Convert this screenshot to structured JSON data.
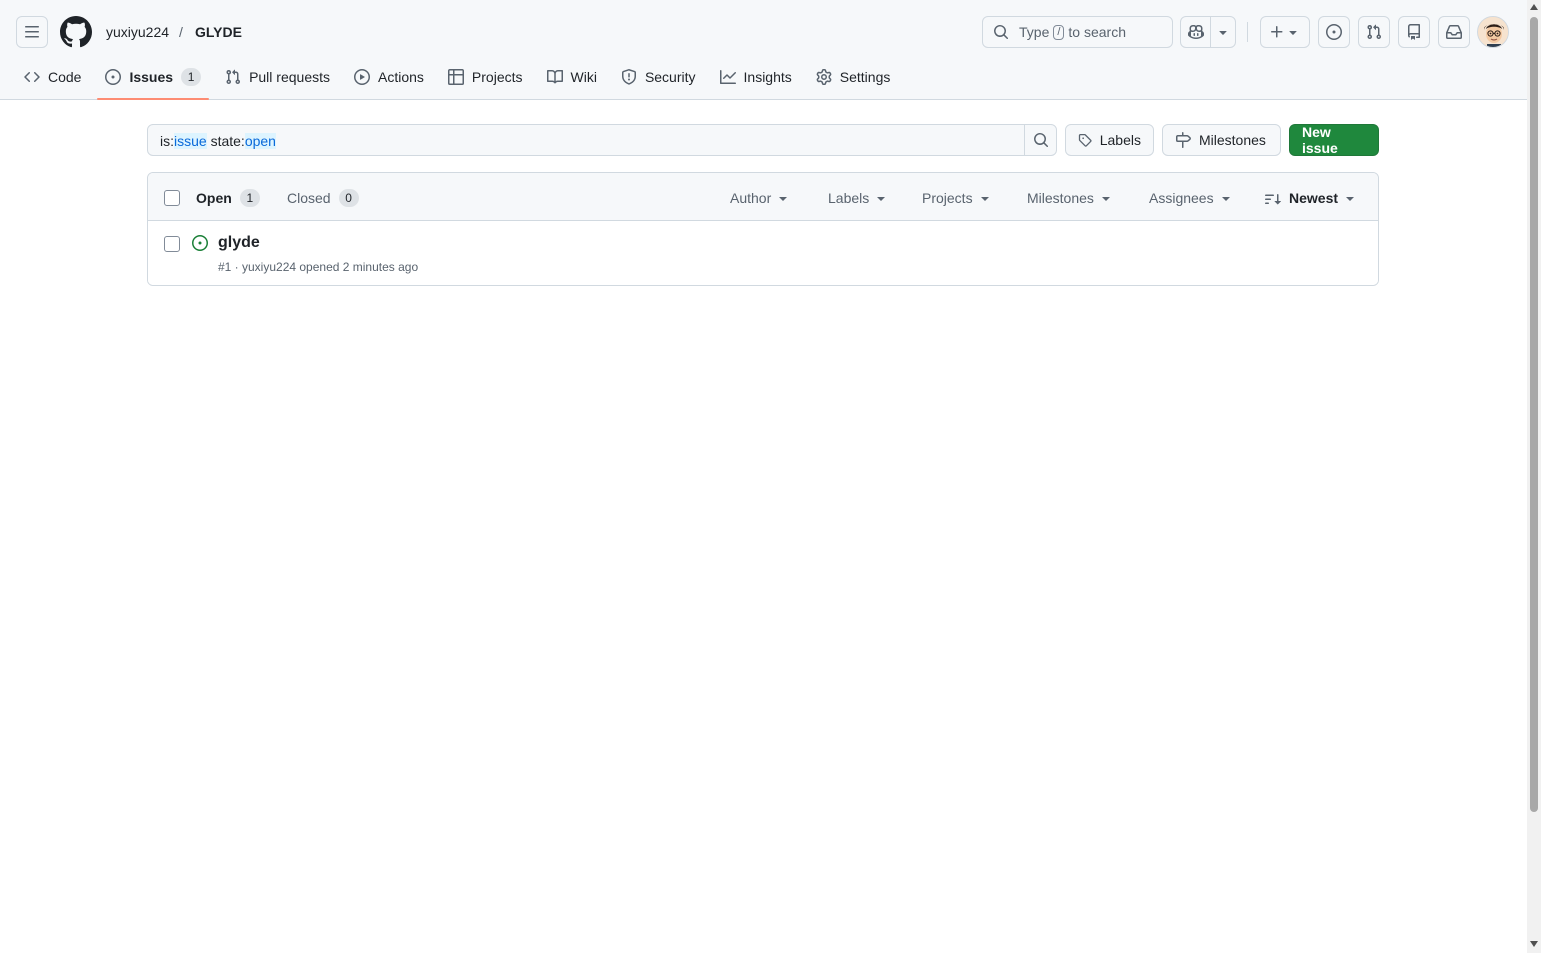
{
  "header": {
    "owner": "yuxiyu224",
    "separator": "/",
    "repo": "GLYDE",
    "search": {
      "pre": "Type",
      "key": "/",
      "post": "to search"
    },
    "icons": [
      "hamburger-icon",
      "github-logo",
      "search-icon",
      "copilot-icon",
      "plus-icon",
      "issue-opened-icon",
      "git-pull-request-icon",
      "repo-icon",
      "inbox-icon"
    ]
  },
  "tabs": [
    {
      "label": "Code",
      "icon": "code-icon"
    },
    {
      "label": "Issues",
      "icon": "issue-opened-icon",
      "count": "1",
      "active": true
    },
    {
      "label": "Pull requests",
      "icon": "git-pull-request-icon"
    },
    {
      "label": "Actions",
      "icon": "play-icon"
    },
    {
      "label": "Projects",
      "icon": "table-icon"
    },
    {
      "label": "Wiki",
      "icon": "book-icon"
    },
    {
      "label": "Security",
      "icon": "shield-icon"
    },
    {
      "label": "Insights",
      "icon": "graph-icon"
    },
    {
      "label": "Settings",
      "icon": "gear-icon"
    }
  ],
  "filter": {
    "q_is": "is:",
    "q_is_val": "issue",
    "q_state": " state:",
    "q_state_val": "open"
  },
  "buttons": {
    "labels": "Labels",
    "milestones": "Milestones",
    "new_issue": "New issue"
  },
  "list": {
    "open_label": "Open",
    "open_count": "1",
    "closed_label": "Closed",
    "closed_count": "0",
    "filters": [
      "Author",
      "Labels",
      "Projects",
      "Milestones",
      "Assignees"
    ],
    "sort": "Newest"
  },
  "issues": [
    {
      "title": "glyde",
      "meta": "#1 · yuxiyu224 opened 2 minutes ago"
    }
  ],
  "colors": {
    "accent_tab": "#fd8c73",
    "primary_button": "#1f883d",
    "open_issue": "#1a7f37"
  }
}
